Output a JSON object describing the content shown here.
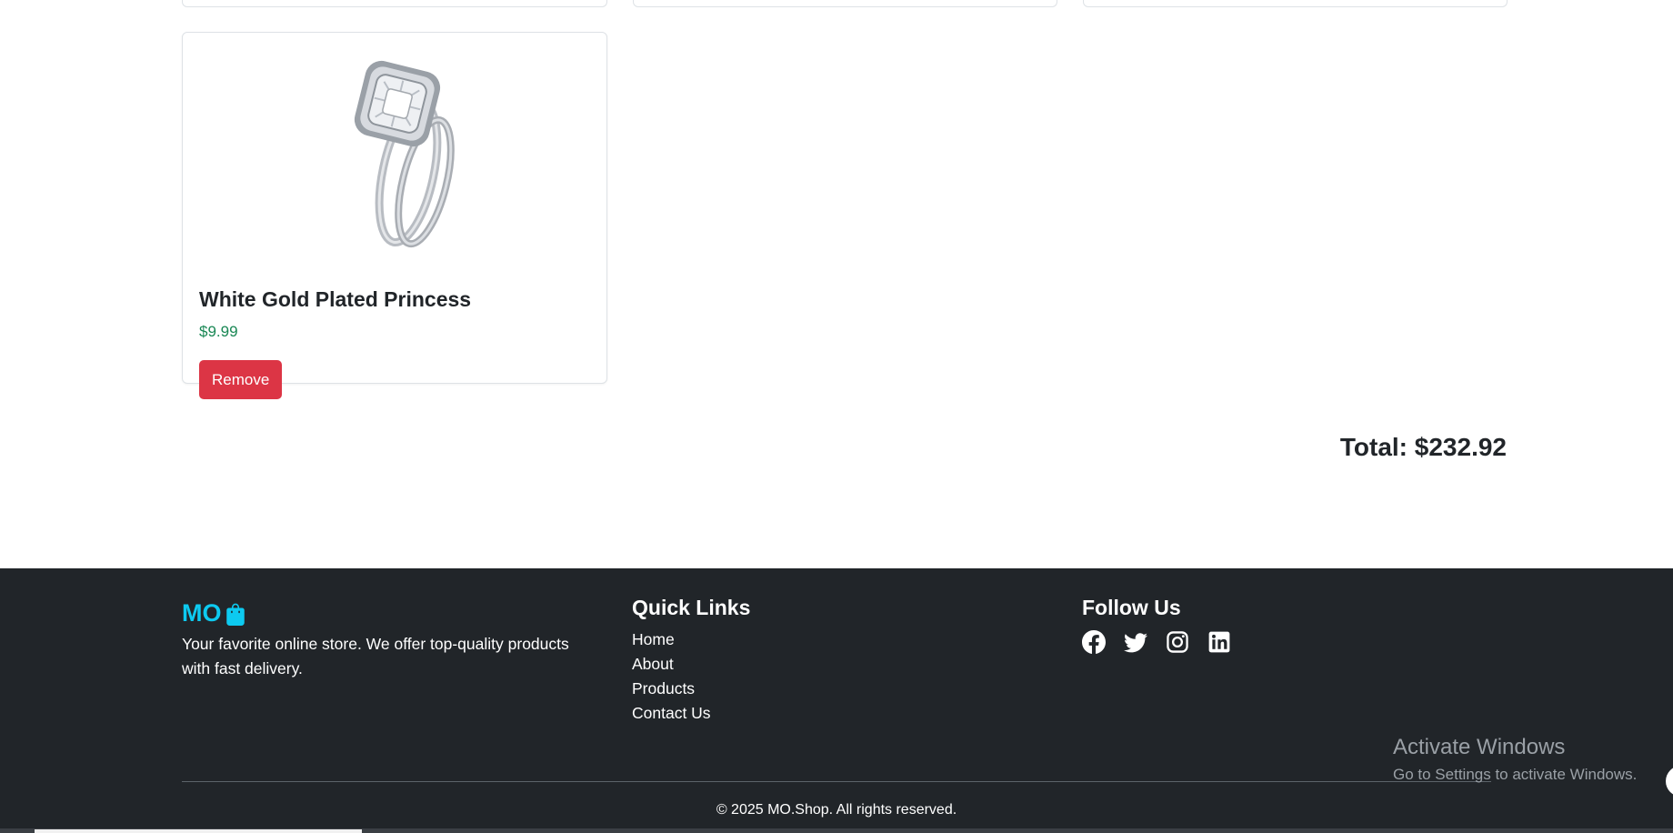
{
  "cart": {
    "item": {
      "title": "White Gold Plated Princess",
      "price": "$9.99",
      "remove_label": "Remove"
    },
    "total": "Total: $232.92"
  },
  "footer": {
    "brand": "MO",
    "brand_icon": "shopping-bag-icon",
    "description": "Your favorite online store. We offer top-quality products with fast delivery.",
    "quick_links_title": "Quick Links",
    "links": [
      "Home",
      "About",
      "Products",
      "Contact Us"
    ],
    "follow_title": "Follow Us",
    "social_icons": [
      "facebook-icon",
      "twitter-icon",
      "instagram-icon",
      "linkedin-icon"
    ],
    "copyright": "© 2025 MO.Shop. All rights reserved."
  },
  "os_overlay": {
    "title": "Activate Windows",
    "subtitle": "Go to Settings to activate Windows."
  },
  "colors": {
    "accent": "#0dcaf0",
    "danger": "#dc3545",
    "price": "#198754",
    "footer_bg": "#212529"
  }
}
